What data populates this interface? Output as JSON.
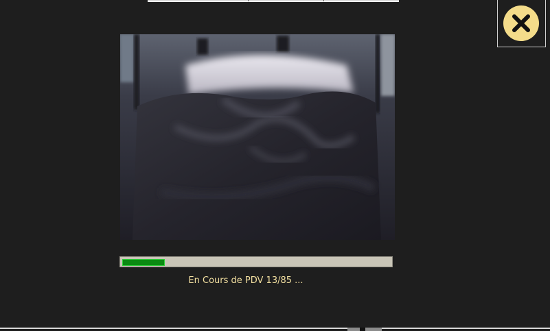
{
  "progress": {
    "fraction": 0.153,
    "status_text": "En Cours de PDV 13/85 ..."
  },
  "icons": {
    "close": "close-icon",
    "preview": "image-preview"
  },
  "colors": {
    "background": "#1e1e1e",
    "close_circle": "#f4dc8a",
    "close_glyph": "#111111",
    "progress_fill": "#0b8a12",
    "progress_track": "#c9c5b7",
    "status_text": "#f2dfa0"
  }
}
